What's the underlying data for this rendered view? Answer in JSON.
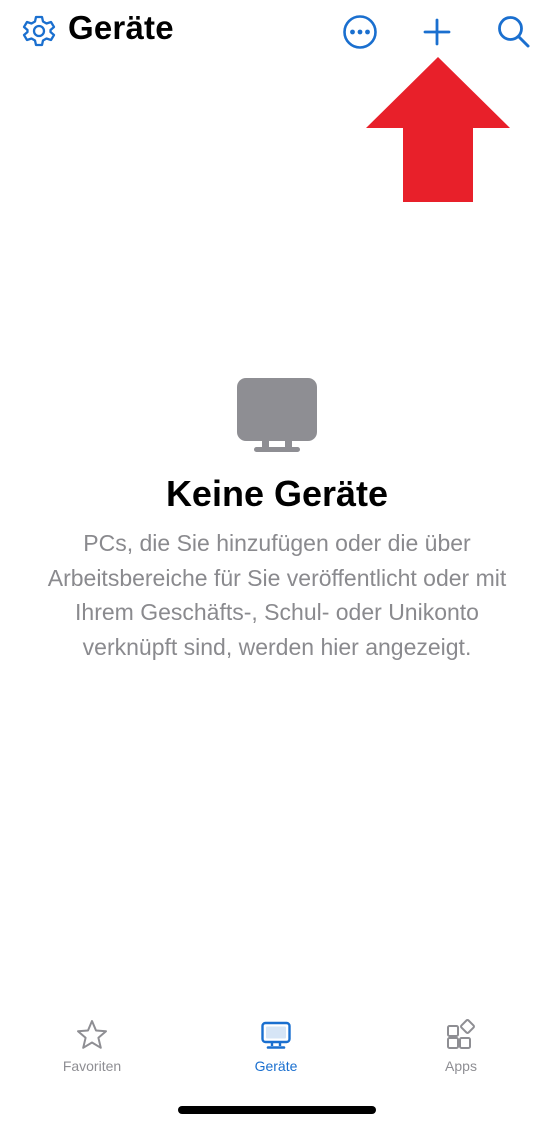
{
  "header": {
    "title": "Geräte",
    "settings_icon": "gear-icon",
    "more_icon": "ellipsis-circle-icon",
    "add_icon": "plus-icon",
    "search_icon": "search-icon"
  },
  "annotation": {
    "icon": "red-arrow-up-icon",
    "color": "#e8202a"
  },
  "empty_state": {
    "icon": "monitor-icon",
    "title": "Keine Geräte",
    "message": "PCs, die Sie hinzufügen oder die über Arbeitsbereiche für Sie veröffentlicht oder mit Ihrem Geschäfts-, Schul- oder Unikonto verknüpft sind, werden hier angezeigt."
  },
  "tabs": [
    {
      "label": "Favoriten",
      "icon": "star-icon",
      "active": false
    },
    {
      "label": "Geräte",
      "icon": "monitor-icon",
      "active": true
    },
    {
      "label": "Apps",
      "icon": "apps-icon",
      "active": false
    }
  ],
  "colors": {
    "accent": "#1a6fcf",
    "secondary_text": "#8a8a8e",
    "tab_inactive": "#8e8e93",
    "empty_icon": "#8e8e93"
  }
}
